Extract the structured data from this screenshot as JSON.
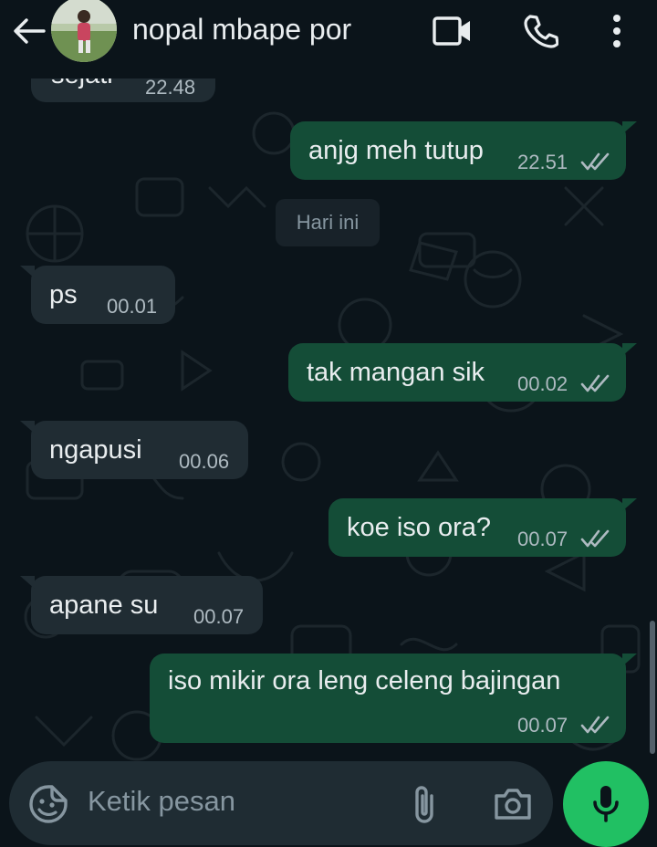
{
  "header": {
    "contact_name": "nopal mbape por"
  },
  "messages": [
    {
      "direction": "in",
      "text": "sejati",
      "time": "22.48"
    },
    {
      "direction": "out",
      "text": "anjg meh tutup",
      "time": "22.51",
      "status": "read"
    },
    {
      "direction": "in",
      "text": "ps",
      "time": "00.01"
    },
    {
      "direction": "out",
      "text": "tak mangan sik",
      "time": "00.02",
      "status": "read"
    },
    {
      "direction": "in",
      "text": "ngapusi",
      "time": "00.06"
    },
    {
      "direction": "out",
      "text": "koe iso ora?",
      "time": "00.07",
      "status": "read"
    },
    {
      "direction": "in",
      "text": "apane su",
      "time": "00.07"
    },
    {
      "direction": "out",
      "text": "iso mikir ora leng celeng bajingan",
      "time": "00.07",
      "status": "read"
    }
  ],
  "date_divider": "Hari ini",
  "composer": {
    "placeholder": "Ketik pesan"
  },
  "colors": {
    "background": "#0b141a",
    "incoming_bubble": "#202c33",
    "outgoing_bubble": "#144d37",
    "accent_green": "#21c063"
  },
  "icons": [
    "back-arrow-icon",
    "video-call-icon",
    "phone-icon",
    "more-options-icon",
    "sticker-icon",
    "attach-icon",
    "camera-icon",
    "mic-icon"
  ]
}
